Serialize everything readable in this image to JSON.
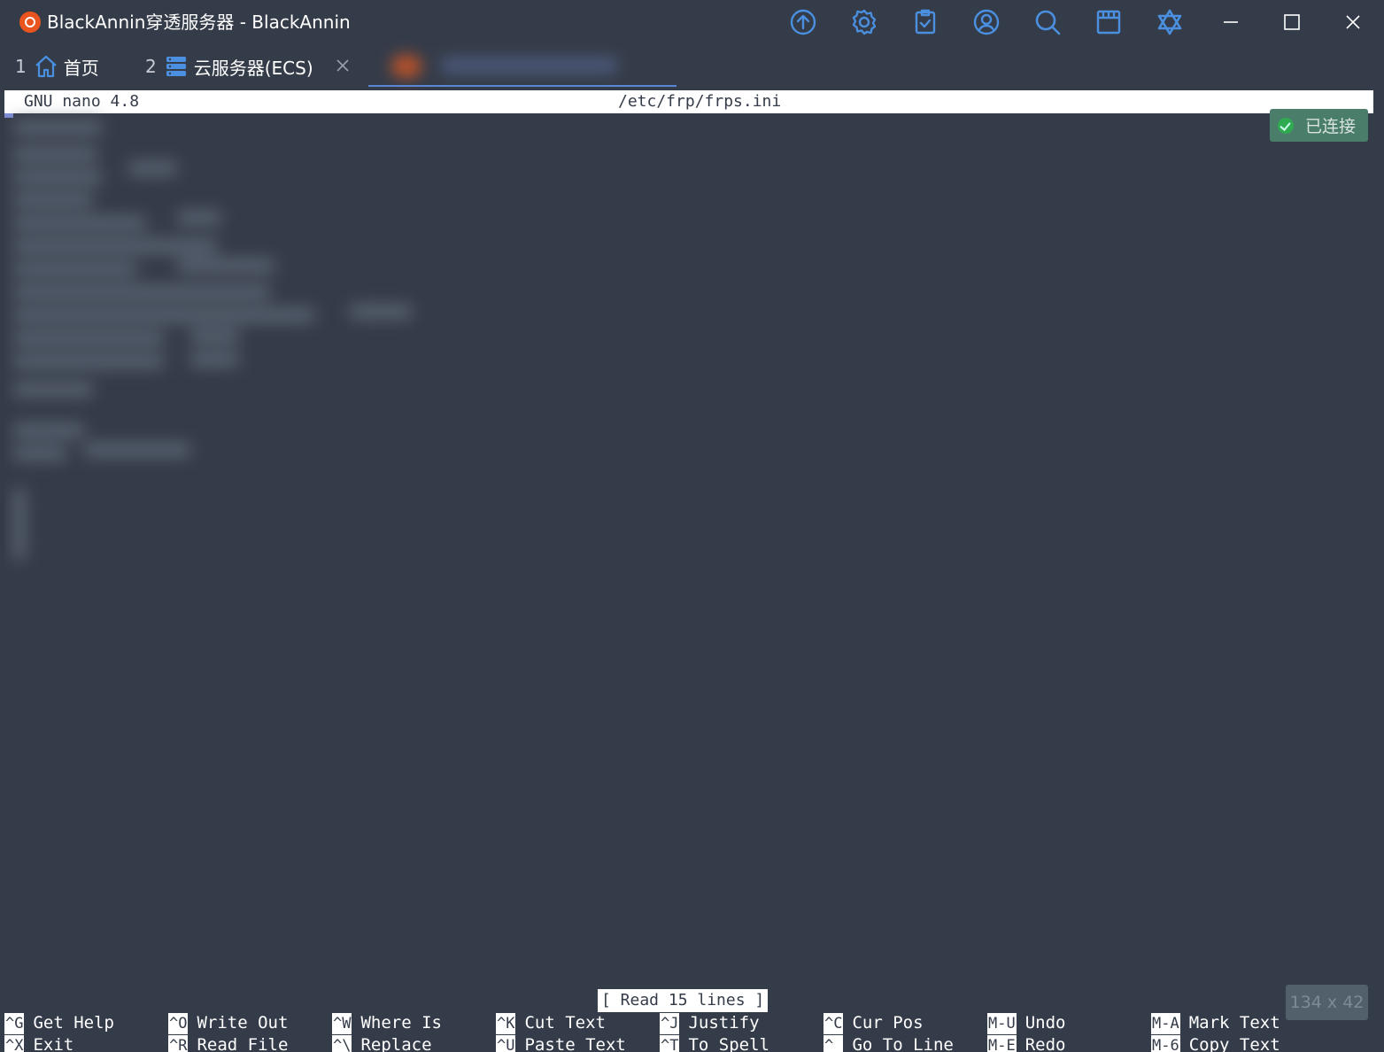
{
  "window": {
    "title": "BlackAnnin穿透服务器 - BlackAnnin"
  },
  "toolbar": {
    "icons": [
      "upload-icon",
      "settings-icon",
      "clipboard-check-icon",
      "user-icon",
      "search-icon",
      "window-icon",
      "star-of-david-icon"
    ]
  },
  "tabs": [
    {
      "number": "1",
      "label": "首页",
      "icon": "home-icon"
    },
    {
      "number": "2",
      "label": "云服务器(ECS)",
      "icon": "server-icon"
    }
  ],
  "nano": {
    "version": "GNU nano 4.8",
    "filename": "/etc/frp/frps.ini",
    "status": "[ Read 15 lines ]",
    "shortcuts_row1": [
      {
        "key": "^G",
        "label": "Get Help"
      },
      {
        "key": "^O",
        "label": "Write Out"
      },
      {
        "key": "^W",
        "label": "Where Is"
      },
      {
        "key": "^K",
        "label": "Cut Text"
      },
      {
        "key": "^J",
        "label": "Justify"
      },
      {
        "key": "^C",
        "label": "Cur Pos"
      },
      {
        "key": "M-U",
        "label": "Undo"
      },
      {
        "key": "M-A",
        "label": "Mark Text"
      }
    ],
    "shortcuts_row2": [
      {
        "key": "^X",
        "label": "Exit"
      },
      {
        "key": "^R",
        "label": "Read File"
      },
      {
        "key": "^\\",
        "label": "Replace"
      },
      {
        "key": "^U",
        "label": "Paste Text"
      },
      {
        "key": "^T",
        "label": "To Spell"
      },
      {
        "key": "^_",
        "label": "Go To Line"
      },
      {
        "key": "M-E",
        "label": "Redo"
      },
      {
        "key": "M-6",
        "label": "Copy Text"
      }
    ]
  },
  "connection": {
    "status": "已连接"
  },
  "terminal_size": "134 x 42",
  "colors": {
    "background": "#353c49",
    "accent": "#4a8fe0",
    "connected": "#2faa51"
  }
}
